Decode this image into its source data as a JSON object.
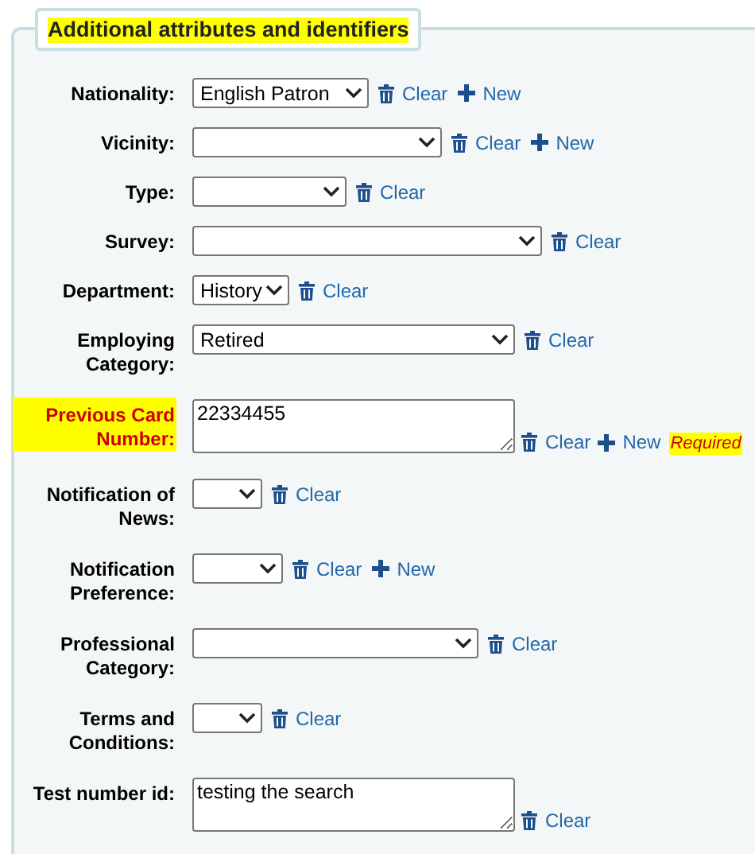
{
  "section": {
    "legend": "Additional attributes and identifiers",
    "legend_highlighted": true
  },
  "fields": [
    {
      "label": "Nationality:",
      "kind": "select",
      "value": "English Patron",
      "actions": [
        {
          "kind": "clear",
          "label": "Clear"
        },
        {
          "kind": "new",
          "label": "New"
        }
      ]
    },
    {
      "label": "Vicinity:",
      "kind": "select",
      "actions": [
        {
          "kind": "clear",
          "label": "Clear"
        },
        {
          "kind": "new",
          "label": "New"
        }
      ]
    },
    {
      "label": "Type:",
      "kind": "select",
      "actions": [
        {
          "kind": "clear",
          "label": "Clear"
        }
      ]
    },
    {
      "label": "Survey:",
      "kind": "select",
      "actions": [
        {
          "kind": "clear",
          "label": "Clear"
        }
      ]
    },
    {
      "label": "Department:",
      "kind": "select",
      "value": "History",
      "actions": [
        {
          "kind": "clear",
          "label": "Clear"
        }
      ]
    },
    {
      "label": "Employing Category:",
      "kind": "select",
      "value": "Retired",
      "actions": [
        {
          "kind": "clear",
          "label": "Clear"
        }
      ]
    },
    {
      "label": "Previous Card Number:",
      "kind": "textarea",
      "value": "22334455",
      "required": true,
      "highlighted": true,
      "note": "Required",
      "actions": [
        {
          "kind": "clear",
          "label": "Clear"
        },
        {
          "kind": "new",
          "label": "New"
        }
      ]
    },
    {
      "label": "Notification of News:",
      "kind": "select",
      "actions": [
        {
          "kind": "clear",
          "label": "Clear"
        }
      ]
    },
    {
      "label": "Notification Preference:",
      "kind": "select",
      "actions": [
        {
          "kind": "clear",
          "label": "Clear"
        },
        {
          "kind": "new",
          "label": "New"
        }
      ]
    },
    {
      "label": "Professional Category:",
      "kind": "select",
      "actions": [
        {
          "kind": "clear",
          "label": "Clear"
        }
      ]
    },
    {
      "label": "Terms and Conditions:",
      "kind": "select",
      "actions": [
        {
          "kind": "clear",
          "label": "Clear"
        }
      ]
    },
    {
      "label": "Test number id:",
      "kind": "textarea",
      "value": "testing the search",
      "actions": [
        {
          "kind": "clear",
          "label": "Clear"
        }
      ]
    }
  ]
}
